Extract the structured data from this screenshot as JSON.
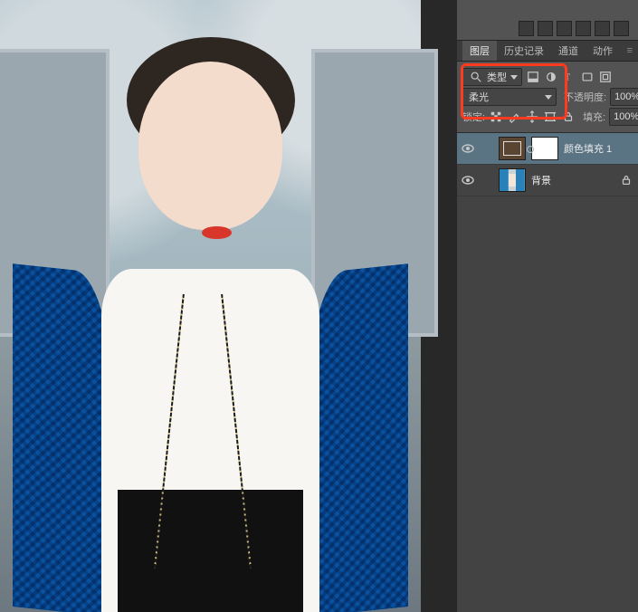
{
  "panel": {
    "tabs": [
      "图层",
      "历史记录",
      "通道",
      "动作"
    ],
    "active_tab": 0
  },
  "filter": {
    "kind_label": "类型"
  },
  "blend": {
    "mode_label": "柔光",
    "opacity_label": "不透明度:",
    "opacity_value": "100%"
  },
  "lock": {
    "label": "锁定:",
    "fill_label": "填充:",
    "fill_value": "100%"
  },
  "layers": [
    {
      "name": "颜色填充 1",
      "visible": true,
      "selected": true,
      "kind": "solid-fill",
      "has_mask": true,
      "locked": false
    },
    {
      "name": "背景",
      "visible": true,
      "selected": false,
      "kind": "image",
      "has_mask": false,
      "locked": true
    }
  ],
  "highlight": {
    "covers": "filter-row + blend-row"
  }
}
